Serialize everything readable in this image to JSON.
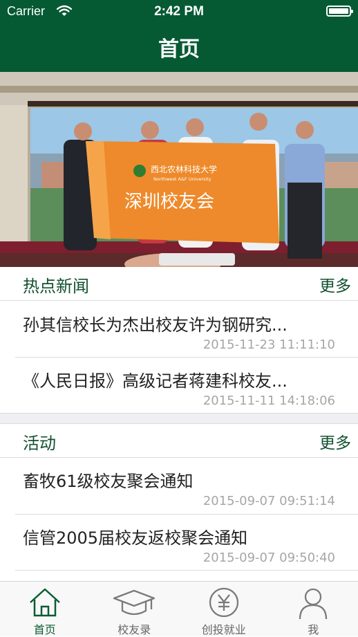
{
  "status_bar": {
    "carrier": "Carrier",
    "time": "2:42 PM"
  },
  "header": {
    "title": "首页"
  },
  "banner": {
    "flag_university": "西北农林科技大学",
    "flag_university_en": "Northwest A&F University",
    "flag_text": "深圳校友会",
    "dots": 3,
    "active_dot": 2
  },
  "sections": [
    {
      "title": "热点新闻",
      "more": "更多",
      "items": [
        {
          "title": "孙其信校长为杰出校友许为钢研究...",
          "date": "2015-11-23 11:11:10"
        },
        {
          "title": "《人民日报》高级记者蒋建科校友...",
          "date": "2015-11-11 14:18:06"
        }
      ]
    },
    {
      "title": "活动",
      "more": "更多",
      "items": [
        {
          "title": "畜牧61级校友聚会通知",
          "date": "2015-09-07 09:51:14"
        },
        {
          "title": "信管2005届校友返校聚会通知",
          "date": "2015-09-07 09:50:40"
        }
      ]
    }
  ],
  "tabbar": {
    "active": 0,
    "tabs": [
      {
        "label": "首页",
        "icon": "home-icon"
      },
      {
        "label": "校友录",
        "icon": "graduation-cap-icon"
      },
      {
        "label": "创投就业",
        "icon": "yuan-coin-icon"
      },
      {
        "label": "我",
        "icon": "person-icon"
      }
    ]
  },
  "colors": {
    "primary": "#055a33",
    "accent_text": "#12502f",
    "date_gray": "#a6a6a6",
    "background_gap": "#efeff4"
  }
}
